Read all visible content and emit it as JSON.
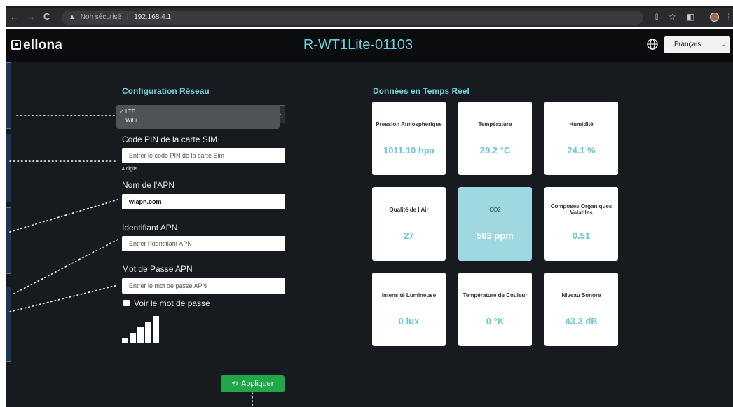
{
  "browser": {
    "back": "←",
    "forward": "→",
    "reload": "C",
    "security_warning_icon": "warning-triangle-icon",
    "security_label": "Non sécurisé",
    "url": "192.168.4.1"
  },
  "header": {
    "logo_text": "ellona",
    "device_title": "R-WT1Lite-01103",
    "language": {
      "selected": "Français"
    }
  },
  "network": {
    "section_title": "Configuration Réseau",
    "options": [
      "LTE",
      "WiFi"
    ],
    "selected": "LTE",
    "sim_pin": {
      "label": "Code PIN de la carte SIM",
      "placeholder": "Entrer le code PIN de la carte Sim",
      "hint": "4 digits"
    },
    "apn_name": {
      "label": "Nom de l'APN",
      "value": "wlapn.com"
    },
    "apn_id": {
      "label": "Identifiant APN",
      "placeholder": "Entrer l'identifiant APN"
    },
    "apn_password": {
      "label": "Mot de Passe APN",
      "placeholder": "Entrer le mot de passe APN"
    },
    "show_password": {
      "label": "Voir le mot de passe",
      "checked": false
    },
    "signal": {
      "bars_total": 5,
      "bars_active": 5
    },
    "apply_label": "Appliquer"
  },
  "realtime": {
    "section_title": "Données en Temps Réel",
    "highlight_color": "#9fd8de",
    "value_color": "#6cc8d4",
    "cards": [
      {
        "label": "Pression Atmosphérique",
        "value": "1011.10 hpa",
        "highlight": false
      },
      {
        "label": "Température",
        "value": "29.2 °C",
        "highlight": false
      },
      {
        "label": "Humidité",
        "value": "24.1 %",
        "highlight": false
      },
      {
        "label": "Qualité de l'Air",
        "value": "27",
        "highlight": false
      },
      {
        "label": "CO2",
        "value": "503 ppm",
        "highlight": true
      },
      {
        "label": "Composés Organiques Volatiles",
        "value": "0.51",
        "highlight": false
      },
      {
        "label": "Intensité Lumineuse",
        "value": "0 lux",
        "highlight": false
      },
      {
        "label": "Température de Couleur",
        "value": "0 °K",
        "highlight": false
      },
      {
        "label": "Niveau Sonore",
        "value": "43.3 dB",
        "highlight": false
      }
    ]
  },
  "colors": {
    "accent": "#6fd0dc",
    "apply_button": "#22a64a",
    "background": "#171a1f"
  }
}
